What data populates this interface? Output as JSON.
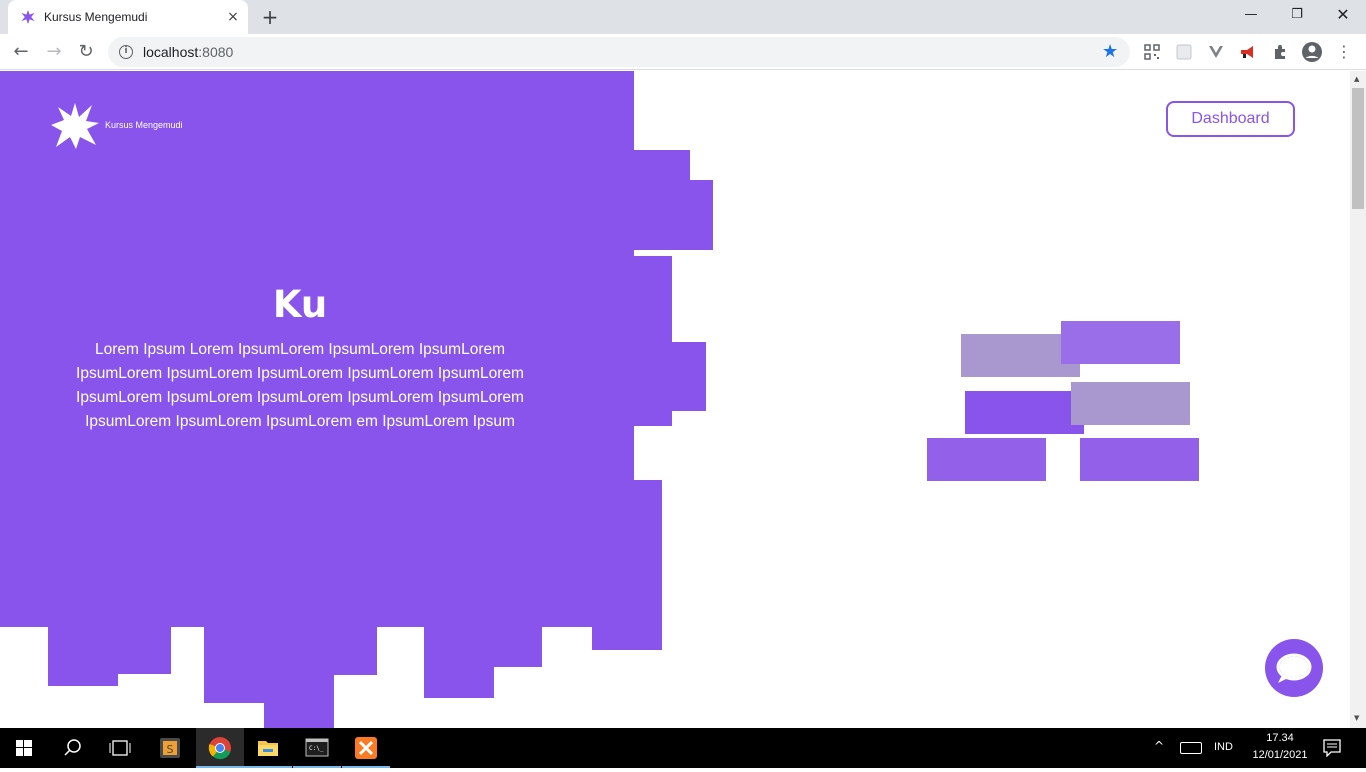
{
  "browser": {
    "tab_title": "Kursus Mengemudi",
    "url_host": "localhost",
    "url_port": ":8080",
    "icons": {
      "close_tab": "×",
      "new_tab": "+",
      "back": "←",
      "forward": "→",
      "reload": "↻",
      "info": "i",
      "star": "★",
      "minimize": "—",
      "maximize": "❐",
      "close_window": "✕",
      "menu": "⋮"
    }
  },
  "page": {
    "brand": "Kursus Mengemudi",
    "dashboard_label": "Dashboard",
    "hero_title": "Ku",
    "hero_text": "Lorem Ipsum Lorem IpsumLorem IpsumLorem IpsumLorem IpsumLorem IpsumLorem IpsumLorem IpsumLorem IpsumLorem IpsumLorem IpsumLorem IpsumLorem IpsumLorem IpsumLorem IpsumLorem IpsumLorem IpsumLorem em IpsumLorem Ipsum"
  },
  "taskbar": {
    "lang": "IND",
    "time": "17.34",
    "date": "12/01/2021",
    "tray_up": "^"
  },
  "colors": {
    "brand_purple": "#8854eb",
    "brick_light": "#a997cf",
    "brick_mid": "#9a6de9",
    "tab_strip": "#dee1e6",
    "taskbar": "#000000"
  }
}
